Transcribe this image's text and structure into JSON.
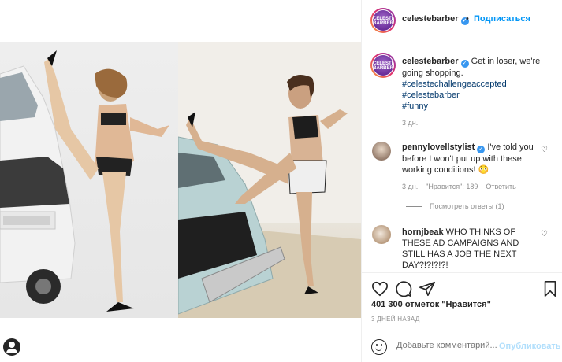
{
  "post": {
    "author": "celestebarber",
    "follow_label": "Подписаться",
    "separator": "•",
    "more_label": "···",
    "avatar_text": "CELESTE BARBER"
  },
  "caption": {
    "username": "celestebarber",
    "text": "Get in loser, we're going shopping.",
    "hashtags": [
      "#celestechallengeaccepted",
      "#celestebarber",
      "#funny"
    ],
    "time": "3 дн."
  },
  "comments": [
    {
      "username": "pennylovellstylist",
      "text": "I've told you before I won't put up with these working conditions! 😳",
      "time": "3 дн.",
      "likes": "\"Нравится\": 189",
      "reply_label": "Ответить",
      "view_replies": "Посмотреть ответы (1)"
    },
    {
      "username": "hornjbeak",
      "text": "WHO THINKS OF THESE AD CAMPAIGNS AND STILL HAS A JOB THE NEXT DAY?!?!?!?!"
    }
  ],
  "actions": {
    "like_icon": "heart-icon",
    "comment_icon": "comment-icon",
    "share_icon": "paper-plane-icon",
    "save_icon": "bookmark-icon"
  },
  "likes_text": "401 300 отметок \"Нравится\"",
  "time_ago": "3 ДНЕЙ НАЗАД",
  "comment_box": {
    "placeholder": "Добавьте комментарий...",
    "post_label": "Опубликовать"
  },
  "colors": {
    "accent": "#0095f6",
    "verified": "#3897f0",
    "post_disabled": "#b2dffc"
  }
}
